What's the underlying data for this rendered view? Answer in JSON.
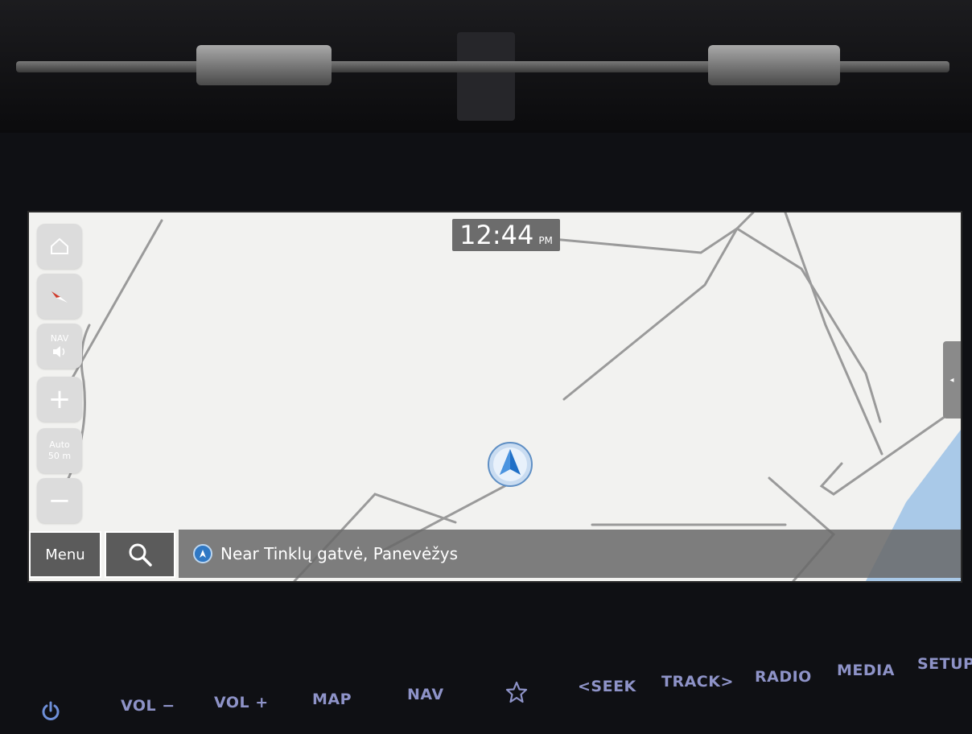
{
  "clock": {
    "time": "12:44",
    "ampm": "PM"
  },
  "map_controls": {
    "nav_label": "NAV",
    "zoom_auto": "Auto",
    "zoom_scale": "50 m",
    "zoom_in": "+",
    "zoom_out": "−"
  },
  "bottom_bar": {
    "menu_label": "Menu",
    "location_text": "Near Tinklų gatvė, Panevėžys"
  },
  "hard_keys": {
    "vol_down": "VOL −",
    "vol_up": "VOL +",
    "map": "MAP",
    "nav": "NAV",
    "seek": "<SEEK",
    "track": "TRACK>",
    "radio": "RADIO",
    "media": "MEDIA",
    "setup": "SETUP"
  },
  "colors": {
    "map_background": "#f2f2f0",
    "road": "#9a9a9a",
    "water": "#a9c9e8",
    "accent_blue": "#2f78c4",
    "hard_key_text": "#8e93c8"
  },
  "icons": [
    "home-icon",
    "compass-icon",
    "speaker-icon",
    "search-icon",
    "location-arrow-icon",
    "vehicle-position-icon",
    "power-icon",
    "star-icon",
    "chevron-left-icon"
  ]
}
